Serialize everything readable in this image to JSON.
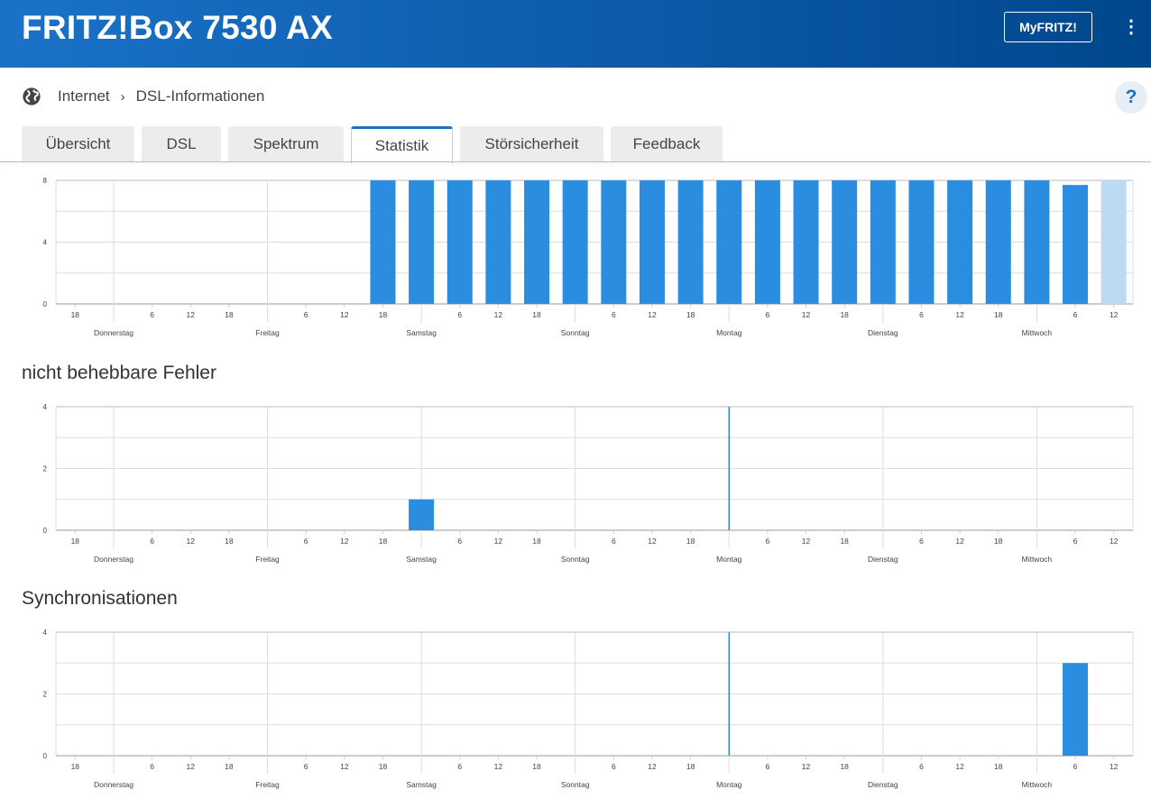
{
  "header": {
    "title": "FRITZ!Box 7530 AX",
    "myfritz_label": "MyFRITZ!",
    "menu_icon": "kebab-menu-icon"
  },
  "breadcrumb": {
    "icon": "globe-icon",
    "items": [
      "Internet",
      "DSL-Informationen"
    ],
    "separator": "›"
  },
  "help_label": "?",
  "tabs": [
    {
      "label": "Übersicht"
    },
    {
      "label": "DSL"
    },
    {
      "label": "Spektrum"
    },
    {
      "label": "Statistik",
      "active": true
    },
    {
      "label": "Störsicherheit"
    },
    {
      "label": "Feedback"
    }
  ],
  "colors": {
    "bar": "#2a8ddf",
    "bar_current": "#bcdaf2",
    "marker": "#2a8ddf"
  },
  "chart_data": [
    {
      "type": "bar",
      "title": "",
      "yticks": [
        0,
        4,
        8
      ],
      "ylim": [
        0,
        8
      ],
      "hour_labels": [
        "18",
        "",
        "6",
        "12",
        "18",
        "",
        "6",
        "12",
        "18",
        "",
        "6",
        "12",
        "18",
        "",
        "6",
        "12",
        "18",
        "",
        "6",
        "12",
        "18",
        "",
        "6",
        "12",
        "18",
        "",
        "6",
        "12"
      ],
      "day_labels": [
        "Donnerstag",
        "Freitag",
        "Samstag",
        "Sonntag",
        "Montag",
        "Dienstag",
        "Mittwoch"
      ],
      "values": [
        0,
        0,
        0,
        0,
        0,
        0,
        0,
        0,
        8,
        8,
        8,
        8,
        8,
        8,
        8,
        8,
        8,
        8,
        8,
        8,
        8,
        8,
        8,
        8,
        8,
        8,
        7.7,
        8
      ],
      "current_index": 27,
      "marker_index": null
    },
    {
      "type": "bar",
      "title": "nicht behebbare Fehler",
      "yticks": [
        0,
        2,
        4
      ],
      "ylim": [
        0,
        4
      ],
      "values": [
        0,
        0,
        0,
        0,
        0,
        0,
        0,
        0,
        0,
        1,
        0,
        0,
        0,
        0,
        0,
        0,
        0,
        0,
        0,
        0,
        0,
        0,
        0,
        0,
        0,
        0,
        0,
        0
      ],
      "current_index": null,
      "marker_index": 17
    },
    {
      "type": "bar",
      "title": "Synchronisationen",
      "yticks": [
        0,
        2,
        4
      ],
      "ylim": [
        0,
        4
      ],
      "values": [
        0,
        0,
        0,
        0,
        0,
        0,
        0,
        0,
        0,
        0,
        0,
        0,
        0,
        0,
        0,
        0,
        0,
        0,
        0,
        0,
        0,
        0,
        0,
        0,
        0,
        0,
        3,
        0
      ],
      "current_index": null,
      "marker_index": 17
    }
  ]
}
